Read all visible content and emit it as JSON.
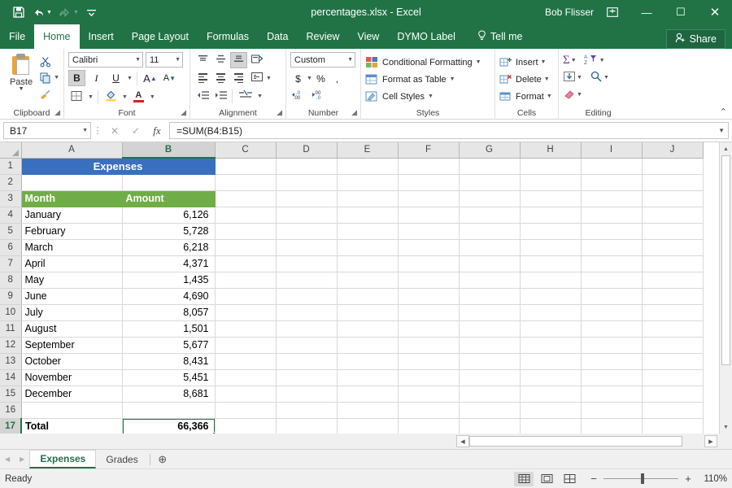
{
  "titlebar": {
    "filename": "percentages.xlsx - Excel",
    "user": "Bob Flisser",
    "qat": {
      "save": "save-icon",
      "undo": "undo-icon",
      "redo": "redo-icon",
      "customize": "customize-qat-icon"
    },
    "ribbon_display_options": "ribbon-display-options-icon",
    "minimize": "—",
    "maximize": "☐",
    "close": "✕"
  },
  "ribbon_tabs": [
    {
      "label": "File",
      "active": false
    },
    {
      "label": "Home",
      "active": true
    },
    {
      "label": "Insert",
      "active": false
    },
    {
      "label": "Page Layout",
      "active": false
    },
    {
      "label": "Formulas",
      "active": false
    },
    {
      "label": "Data",
      "active": false
    },
    {
      "label": "Review",
      "active": false
    },
    {
      "label": "View",
      "active": false
    },
    {
      "label": "DYMO Label",
      "active": false
    }
  ],
  "tellme": {
    "label": "Tell me",
    "icon": "lightbulb-icon"
  },
  "share": {
    "label": "Share",
    "icon": "share-person-icon"
  },
  "ribbon": {
    "clipboard": {
      "label": "Clipboard",
      "paste": "Paste",
      "cut": "scissors-icon",
      "copy": "copy-icon",
      "format_painter": "format-painter-icon"
    },
    "font": {
      "label": "Font",
      "font_name": "Calibri",
      "font_size": "11",
      "bold": "B",
      "italic": "I",
      "underline": "U",
      "grow_font": "A",
      "shrink_font": "A",
      "borders": "borders-icon",
      "fill_color": "fill-color-icon",
      "font_color": "A"
    },
    "alignment": {
      "label": "Alignment",
      "top_align": "top-align-icon",
      "middle_align": "middle-align-icon",
      "bottom_align": "bottom-align-icon",
      "orientation": "orientation-icon",
      "align_left": "align-left-icon",
      "align_center": "align-center-icon",
      "align_right": "align-right-icon",
      "wrap_text": "wrap-text-icon",
      "decrease_indent": "decrease-indent-icon",
      "increase_indent": "increase-indent-icon",
      "merge_center": "merge-center-icon"
    },
    "number": {
      "label": "Number",
      "format": "Custom",
      "accounting": "$",
      "percent": "%",
      "comma": ",",
      "increase_decimal": "increase-decimal-icon",
      "decrease_decimal": "decrease-decimal-icon"
    },
    "styles": {
      "label": "Styles",
      "items": [
        {
          "label": "Conditional Formatting",
          "icon": "conditional-formatting-icon"
        },
        {
          "label": "Format as Table",
          "icon": "format-as-table-icon"
        },
        {
          "label": "Cell Styles",
          "icon": "cell-styles-icon"
        }
      ]
    },
    "cells": {
      "label": "Cells",
      "items": [
        {
          "label": "Insert",
          "icon": "insert-cells-icon"
        },
        {
          "label": "Delete",
          "icon": "delete-cells-icon"
        },
        {
          "label": "Format",
          "icon": "format-cells-icon"
        }
      ]
    },
    "editing": {
      "label": "Editing",
      "autosum": "Σ",
      "fill": "fill-down-icon",
      "clear": "eraser-icon",
      "sort_filter": "sort-filter-icon",
      "find_select": "find-select-icon"
    }
  },
  "formulabar": {
    "namebox": "B17",
    "cancel": "✕",
    "enter": "✓",
    "insert_function": "fx",
    "formula": "=SUM(B4:B15)"
  },
  "grid": {
    "columns": [
      "A",
      "B",
      "C",
      "D",
      "E",
      "F",
      "G",
      "H",
      "I",
      "J"
    ],
    "selected_column": "B",
    "selected_row": 17,
    "selected_cell": "B17",
    "rows": [
      {
        "num": "1",
        "type": "title",
        "a": "Expenses"
      },
      {
        "num": "2",
        "type": "blank",
        "a": "",
        "b": ""
      },
      {
        "num": "3",
        "type": "header",
        "a": "Month",
        "b": "Amount"
      },
      {
        "num": "4",
        "type": "data",
        "a": "January",
        "b": "6,126"
      },
      {
        "num": "5",
        "type": "data",
        "a": "February",
        "b": "5,728"
      },
      {
        "num": "6",
        "type": "data",
        "a": "March",
        "b": "6,218"
      },
      {
        "num": "7",
        "type": "data",
        "a": "April",
        "b": "4,371"
      },
      {
        "num": "8",
        "type": "data",
        "a": "May",
        "b": "1,435"
      },
      {
        "num": "9",
        "type": "data",
        "a": "June",
        "b": "4,690"
      },
      {
        "num": "10",
        "type": "data",
        "a": "July",
        "b": "8,057"
      },
      {
        "num": "11",
        "type": "data",
        "a": "August",
        "b": "1,501"
      },
      {
        "num": "12",
        "type": "data",
        "a": "September",
        "b": "5,677"
      },
      {
        "num": "13",
        "type": "data",
        "a": "October",
        "b": "8,431"
      },
      {
        "num": "14",
        "type": "data",
        "a": "November",
        "b": "5,451"
      },
      {
        "num": "15",
        "type": "data",
        "a": "December",
        "b": "8,681"
      },
      {
        "num": "16",
        "type": "blank",
        "a": "",
        "b": ""
      },
      {
        "num": "17",
        "type": "total",
        "a": "Total",
        "b": "66,366"
      },
      {
        "num": "18",
        "type": "blank",
        "a": "",
        "b": ""
      }
    ]
  },
  "sheettabs": {
    "prev": "◀",
    "next": "▶",
    "tabs": [
      {
        "label": "Expenses",
        "active": true
      },
      {
        "label": "Grades",
        "active": false
      }
    ],
    "add": "⊕"
  },
  "statusbar": {
    "status": "Ready",
    "views": [
      {
        "name": "normal-view",
        "active": true
      },
      {
        "name": "page-layout-view",
        "active": false
      },
      {
        "name": "page-break-view",
        "active": false
      }
    ],
    "zoom_out": "−",
    "zoom_in": "+",
    "zoom_level": "110%"
  },
  "colors": {
    "brand_green": "#217346",
    "title_cell_blue": "#3a6fbf",
    "header_cell_green": "#70ad47",
    "selection_green": "#217346"
  }
}
